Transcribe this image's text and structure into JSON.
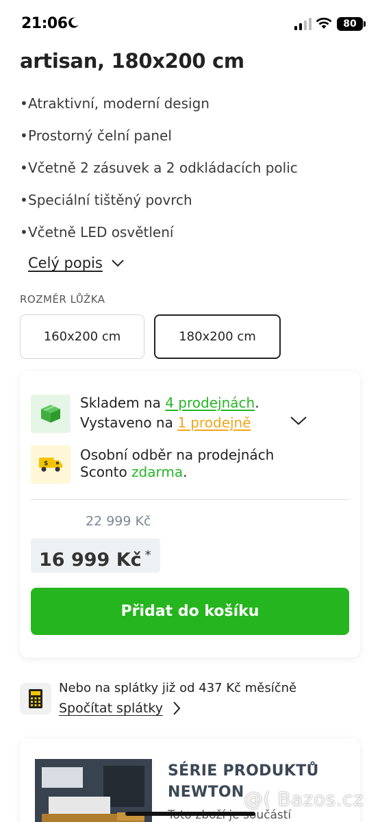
{
  "status_bar": {
    "time": "21:06",
    "battery": "80"
  },
  "product": {
    "title": "artisan, 180x200 cm"
  },
  "features": [
    "Atraktivní, moderní design",
    "Prostorný čelní panel",
    "Včetně 2 zásuvek a 2 odkládacích polic",
    "Speciální tištěný povrch",
    "Včetně LED osvětlení"
  ],
  "description_toggle": "Celý popis",
  "size": {
    "label": "ROZMĚR LŮŽKA",
    "options": [
      "160x200 cm",
      "180x200 cm"
    ],
    "selected": "180x200 cm"
  },
  "availability": {
    "stock_prefix": "Skladem na ",
    "stock_link": "4 prodejnách",
    "stock_suffix": ".",
    "display_prefix": "Vystaveno na ",
    "display_link": "1 prodejně",
    "pickup_line1": "Osobní odběr na prodejnách",
    "pickup_prefix": "Sconto ",
    "pickup_free": "zdarma",
    "pickup_suffix": "."
  },
  "price": {
    "old": "22 999 Kč",
    "new": "16 999 Kč",
    "asterisk": "*"
  },
  "cart_button": "Přidat do košíku",
  "installments": {
    "text": "Nebo na splátky již od 437 Kč měsíčně",
    "link": "Spočítat splátky"
  },
  "series": {
    "title_line1": "SÉRIE PRODUKTŮ",
    "title_line2": "NEWTON",
    "subtitle": "Toto zboží je součástí"
  },
  "watermark": "@( Bazos.cz",
  "colors": {
    "accent_green": "#25b51e",
    "link_orange": "#f2a51a",
    "price_bg": "#eef1f3"
  }
}
